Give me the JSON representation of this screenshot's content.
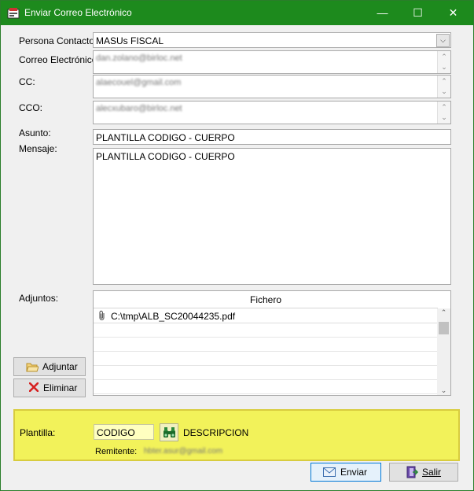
{
  "window": {
    "title": "Enviar Correo Electrónico",
    "minimize_glyph": "—",
    "maximize_glyph": "☐",
    "close_glyph": "✕"
  },
  "form": {
    "contact_label": "Persona Contacto:",
    "contact_value": "MASUs FISCAL",
    "email_label": "Correo Electrónico:",
    "email_value": "dan.zolano@birloc.net",
    "cc_label": "CC:",
    "cc_value": "alaecouel@gmail.com",
    "cco_label": "CCO:",
    "cco_value": "alecxubaro@birloc.net",
    "subject_label": "Asunto:",
    "subject_value": "PLANTILLA CODIGO - CUERPO",
    "message_label": "Mensaje:",
    "message_value": "PLANTILLA CODIGO - CUERPO"
  },
  "attachments": {
    "label": "Adjuntos:",
    "column_header": "Fichero",
    "files": [
      "C:\\tmp\\ALB_SC20044235.pdf"
    ],
    "add_button": "Adjuntar",
    "remove_button": "Eliminar"
  },
  "template": {
    "label": "Plantilla:",
    "code_value": "CODIGO",
    "description": "DESCRIPCION",
    "sender_label": "Remitente:",
    "sender_value": "hbter.asur@gmail.com"
  },
  "actions": {
    "send_button": "Enviar",
    "exit_button": "Salir"
  },
  "colors": {
    "titlebar": "#1d8a1d",
    "template_panel": "#f2f25a"
  }
}
